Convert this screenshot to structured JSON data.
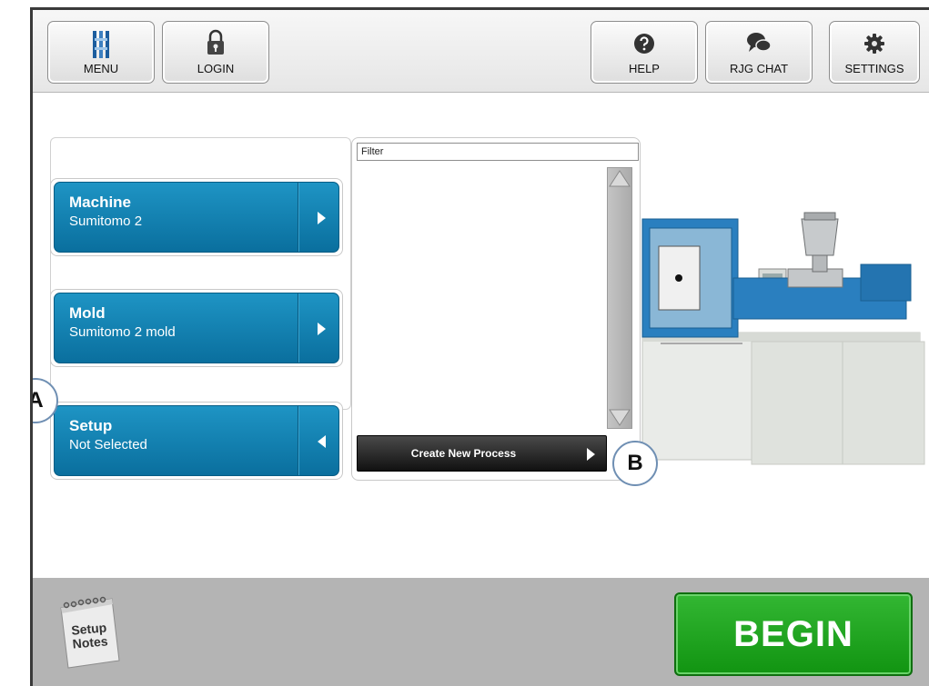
{
  "toolbar": {
    "menu_label": "MENU",
    "login_label": "LOGIN",
    "help_label": "HELP",
    "chat_label": "RJG CHAT",
    "settings_label": "SETTINGS"
  },
  "selectors": {
    "machine": {
      "title": "Machine",
      "value": "Sumitomo 2"
    },
    "mold": {
      "title": "Mold",
      "value": "Sumitomo 2 mold"
    },
    "setup": {
      "title": "Setup",
      "value": "Not Selected"
    }
  },
  "process_panel": {
    "filter_value": "Filter",
    "create_button_label": "Create New Process"
  },
  "callouts": {
    "a": "A",
    "b": "B"
  },
  "footer": {
    "notes_label_line1": "Setup",
    "notes_label_line2": "Notes",
    "begin_label": "BEGIN"
  },
  "colors": {
    "selector_blue": "#0a7fb4",
    "begin_green": "#1aa31a",
    "footer_gray": "#b4b4b4"
  }
}
